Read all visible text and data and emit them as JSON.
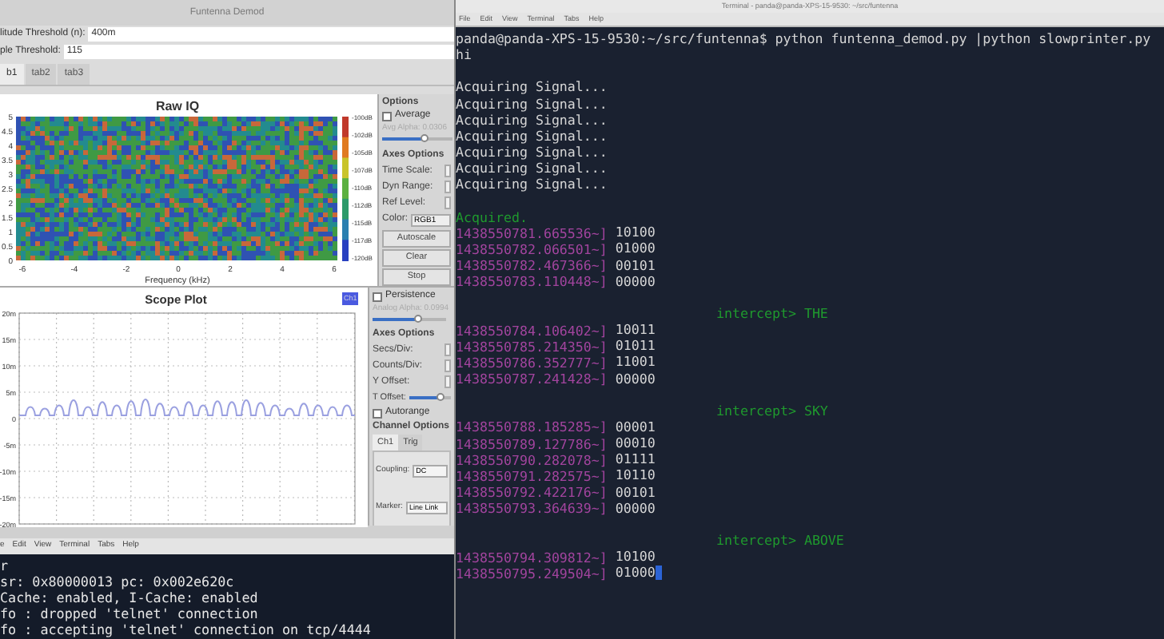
{
  "demod_window": {
    "title": "Funtenna Demod",
    "fields": [
      {
        "label": "litude Threshold (n):",
        "value": "400m"
      },
      {
        "label": "ple Threshold:",
        "value": "115"
      }
    ],
    "tabs": [
      {
        "label": "b1",
        "selected": true
      },
      {
        "label": "tab2",
        "selected": false
      },
      {
        "label": "tab3",
        "selected": false
      }
    ],
    "raw_iq": {
      "title": "Raw IQ",
      "xlabel": "Frequency (kHz)",
      "xticks": [
        "-6",
        "-4",
        "-2",
        "0",
        "2",
        "4",
        "6"
      ],
      "yticks": [
        "5",
        "4.5",
        "4",
        "3.5",
        "3",
        "2.5",
        "2",
        "1.5",
        "1",
        "0.5",
        "0"
      ],
      "colorbar_labels": [
        "-100dB",
        "-102dB",
        "-105dB",
        "-107dB",
        "-110dB",
        "-112dB",
        "-115dB",
        "-117dB",
        "-120dB"
      ]
    },
    "raw_iq_options": {
      "heading": "Options",
      "average": {
        "label": "Average",
        "checked": false
      },
      "alpha_label": "Avg Alpha: 0.0306",
      "alpha_slider": {
        "level": 0.6
      },
      "axes_heading": "Axes Options",
      "rows": [
        "Time Scale:",
        "Dyn Range:",
        "Ref Level:"
      ],
      "color_label": "Color:",
      "color_value": "RGB1",
      "buttons": [
        "Autoscale",
        "Clear",
        "Stop"
      ]
    },
    "scope": {
      "title": "Scope Plot",
      "legend": "Ch1",
      "yticks": [
        "20m",
        "15m",
        "10m",
        "5m",
        "0",
        "-5m",
        "-10m",
        "-15m",
        "-20m"
      ]
    },
    "scope_options": {
      "persistence": {
        "label": "Persistence",
        "checked": false
      },
      "alpha_label": "Analog Alpha: 0.0994",
      "alpha_slider": {
        "level": 0.6
      },
      "axes_heading": "Axes Options",
      "rows": [
        "Secs/Div:",
        "Counts/Div:",
        "Y Offset:"
      ],
      "t_offset_label": "T Offset:",
      "t_offset_slider": {
        "level": 0.75
      },
      "autorange": {
        "label": "Autorange",
        "checked": false
      },
      "channel_heading": "Channel Options",
      "channel_tabs": [
        {
          "label": "Ch1",
          "selected": true
        },
        {
          "label": "Trig",
          "selected": false
        }
      ],
      "coupling_label": "Coupling:",
      "coupling_value": "DC",
      "marker_label": "Marker:",
      "marker_value": "Line Link"
    }
  },
  "bottom_terminal": {
    "menu": [
      "e",
      "Edit",
      "View",
      "Terminal",
      "Tabs",
      "Help"
    ],
    "lines": [
      "r",
      "sr: 0x80000013 pc: 0x002e620c",
      "Cache: enabled, I-Cache: enabled",
      "fo : dropped 'telnet' connection",
      "fo : accepting 'telnet' connection on tcp/4444"
    ]
  },
  "terminal": {
    "title": "Terminal - panda@panda-XPS-15-9530: ~/src/funtenna",
    "menu": [
      "File",
      "Edit",
      "View",
      "Terminal",
      "Tabs",
      "Help"
    ],
    "lines": [
      {
        "kind": "text",
        "text": "panda@panda-XPS-15-9530:~/src/funtenna$ python funtenna_demod.py |python slowprinter.py"
      },
      {
        "kind": "text",
        "text": "hi"
      },
      {
        "kind": "blank"
      },
      {
        "kind": "text",
        "text": "Acquiring Signal..."
      },
      {
        "kind": "text",
        "text": "Acquiring Signal..."
      },
      {
        "kind": "text",
        "text": "Acquiring Signal..."
      },
      {
        "kind": "text",
        "text": "Acquiring Signal..."
      },
      {
        "kind": "text",
        "text": "Acquiring Signal..."
      },
      {
        "kind": "text",
        "text": "Acquiring Signal..."
      },
      {
        "kind": "text",
        "text": "Acquiring Signal..."
      },
      {
        "kind": "blank"
      },
      {
        "kind": "status",
        "text": "Acquired."
      },
      {
        "kind": "data",
        "stamp": "1438550781.665536~]",
        "bits": "10100",
        "cursor": false
      },
      {
        "kind": "data",
        "stamp": "1438550782.066501~]",
        "bits": "01000",
        "cursor": false
      },
      {
        "kind": "data",
        "stamp": "1438550782.467366~]",
        "bits": "00101",
        "cursor": false
      },
      {
        "kind": "data",
        "stamp": "1438550783.110448~]",
        "bits": "00000",
        "cursor": false
      },
      {
        "kind": "blank"
      },
      {
        "kind": "intercept",
        "text": "intercept> THE"
      },
      {
        "kind": "data",
        "stamp": "1438550784.106402~]",
        "bits": "10011",
        "cursor": false
      },
      {
        "kind": "data",
        "stamp": "1438550785.214350~]",
        "bits": "01011",
        "cursor": false
      },
      {
        "kind": "data",
        "stamp": "1438550786.352777~]",
        "bits": "11001",
        "cursor": false
      },
      {
        "kind": "data",
        "stamp": "1438550787.241428~]",
        "bits": "00000",
        "cursor": false
      },
      {
        "kind": "blank"
      },
      {
        "kind": "intercept",
        "text": "intercept> SKY"
      },
      {
        "kind": "data",
        "stamp": "1438550788.185285~]",
        "bits": "00001",
        "cursor": false
      },
      {
        "kind": "data",
        "stamp": "1438550789.127786~]",
        "bits": "00010",
        "cursor": false
      },
      {
        "kind": "data",
        "stamp": "1438550790.282078~]",
        "bits": "01111",
        "cursor": false
      },
      {
        "kind": "data",
        "stamp": "1438550791.282575~]",
        "bits": "10110",
        "cursor": false
      },
      {
        "kind": "data",
        "stamp": "1438550792.422176~]",
        "bits": "00101",
        "cursor": false
      },
      {
        "kind": "data",
        "stamp": "1438550793.364639~]",
        "bits": "00000",
        "cursor": false
      },
      {
        "kind": "blank"
      },
      {
        "kind": "intercept",
        "text": "intercept> ABOVE"
      },
      {
        "kind": "data",
        "stamp": "1438550794.309812~]",
        "bits": "10100",
        "cursor": false
      },
      {
        "kind": "data",
        "stamp": "1438550795.249504~]",
        "bits": "01000",
        "cursor": true
      }
    ]
  }
}
